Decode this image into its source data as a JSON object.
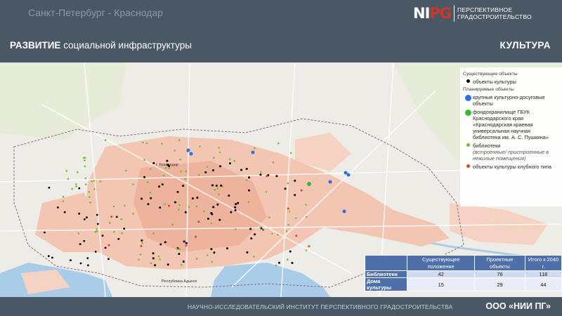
{
  "header": {
    "city_route": "Санкт-Петербург - Краснодар",
    "logo_mark_part1": "NI",
    "logo_mark_part2": "PG",
    "logo_line1": "ПЕРСПЕКТИВНОЕ",
    "logo_line2": "ГРАДОСТРОИТЕЛЬСТВО"
  },
  "title_bar": {
    "title_bold": "РАЗВИТИЕ",
    "title_rest": " социальной инфраструктуры",
    "section": "КУЛЬТУРА"
  },
  "map": {
    "city_label": "г. Краснодар",
    "region_label": "Республика Адыгея",
    "colors": {
      "urban": "#f3c5b3",
      "water": "#a9cde8",
      "green": "#d9e8c4",
      "boundary": "#8a6a8a",
      "culture_existing": "#000000",
      "culture_large": "#2f6fe0",
      "fund_storage": "#3fb83a",
      "library": "#6fbf2f",
      "club": "#e0452b"
    }
  },
  "legend": {
    "existing_header": "Существующие объекты",
    "existing_culture": "объекты культуры",
    "planned_header": "Планируемые объекты",
    "large_culture": "крупные культурно-досуговые объекты",
    "fund_storage": "фондохранилище ГБУК Краснодарского края «Краснодарская краевая универсальная научная библиотека им. А. С. Пушкина»",
    "libraries": "библиотеки",
    "libraries_note": "(встроенные/ пристроенные в нежилые помещения)",
    "club_culture": "объекты культуры клубного типа"
  },
  "stats_table": {
    "headers": [
      "",
      "Существующее положение",
      "Проектные объекты",
      "Итого к 2040 г."
    ],
    "rows": [
      {
        "label": "Библиотеки",
        "existing": "42",
        "project": "76",
        "total": "118"
      },
      {
        "label": "Дома культуры",
        "existing": "15",
        "project": "29",
        "total": "44"
      }
    ]
  },
  "footer": {
    "institute": "НАУЧНО-ИССЛЕДОВАТЕЛЬСКИЙ ИНСТИТУТ ПЕРСПЕКТИВНОГО ГРАДОСТРОИТЕЛЬСТВА",
    "brand": "ООО «НИИ ПГ»"
  }
}
